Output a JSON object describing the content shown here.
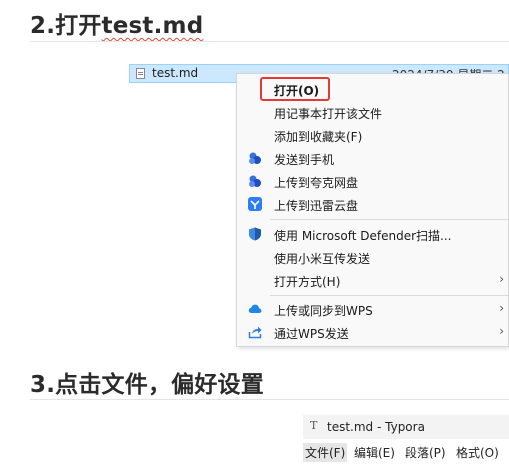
{
  "headings": {
    "h1_prefix": "2.打开",
    "h1_word": "test.md",
    "h2": "3.点击文件，偏好设置"
  },
  "explorer": {
    "file_name": "test.md",
    "date_partial": "2024/7/30 星期二 2"
  },
  "context_menu": {
    "items": [
      {
        "label": "打开(O)",
        "icon": "none",
        "bold": true
      },
      {
        "label": "用记事本打开该文件",
        "icon": "none"
      },
      {
        "label": "添加到收藏夹(F)",
        "icon": "none"
      },
      {
        "label": "发送到手机",
        "icon": "cloud-send-icon"
      },
      {
        "label": "上传到夸克网盘",
        "icon": "quark-cloud-icon"
      },
      {
        "label": "上传到迅雷云盘",
        "icon": "xunlei-icon"
      },
      {
        "label": "使用 Microsoft Defender扫描...",
        "icon": "defender-shield-icon"
      },
      {
        "label": "使用小米互传发送",
        "icon": "none"
      },
      {
        "label": "打开方式(H)",
        "icon": "none",
        "submenu": true
      },
      {
        "label": "上传或同步到WPS",
        "icon": "wps-cloud-icon",
        "submenu": true
      },
      {
        "label": "通过WPS发送",
        "icon": "share-icon",
        "submenu": true
      }
    ],
    "submenu_arrow": "›",
    "highlight_color": "#e53935"
  },
  "typora": {
    "icon_letter": "T",
    "title": "test.md - Typora",
    "menu": [
      "文件(F)",
      "编辑(E)",
      "段落(P)",
      "格式(O)"
    ]
  }
}
